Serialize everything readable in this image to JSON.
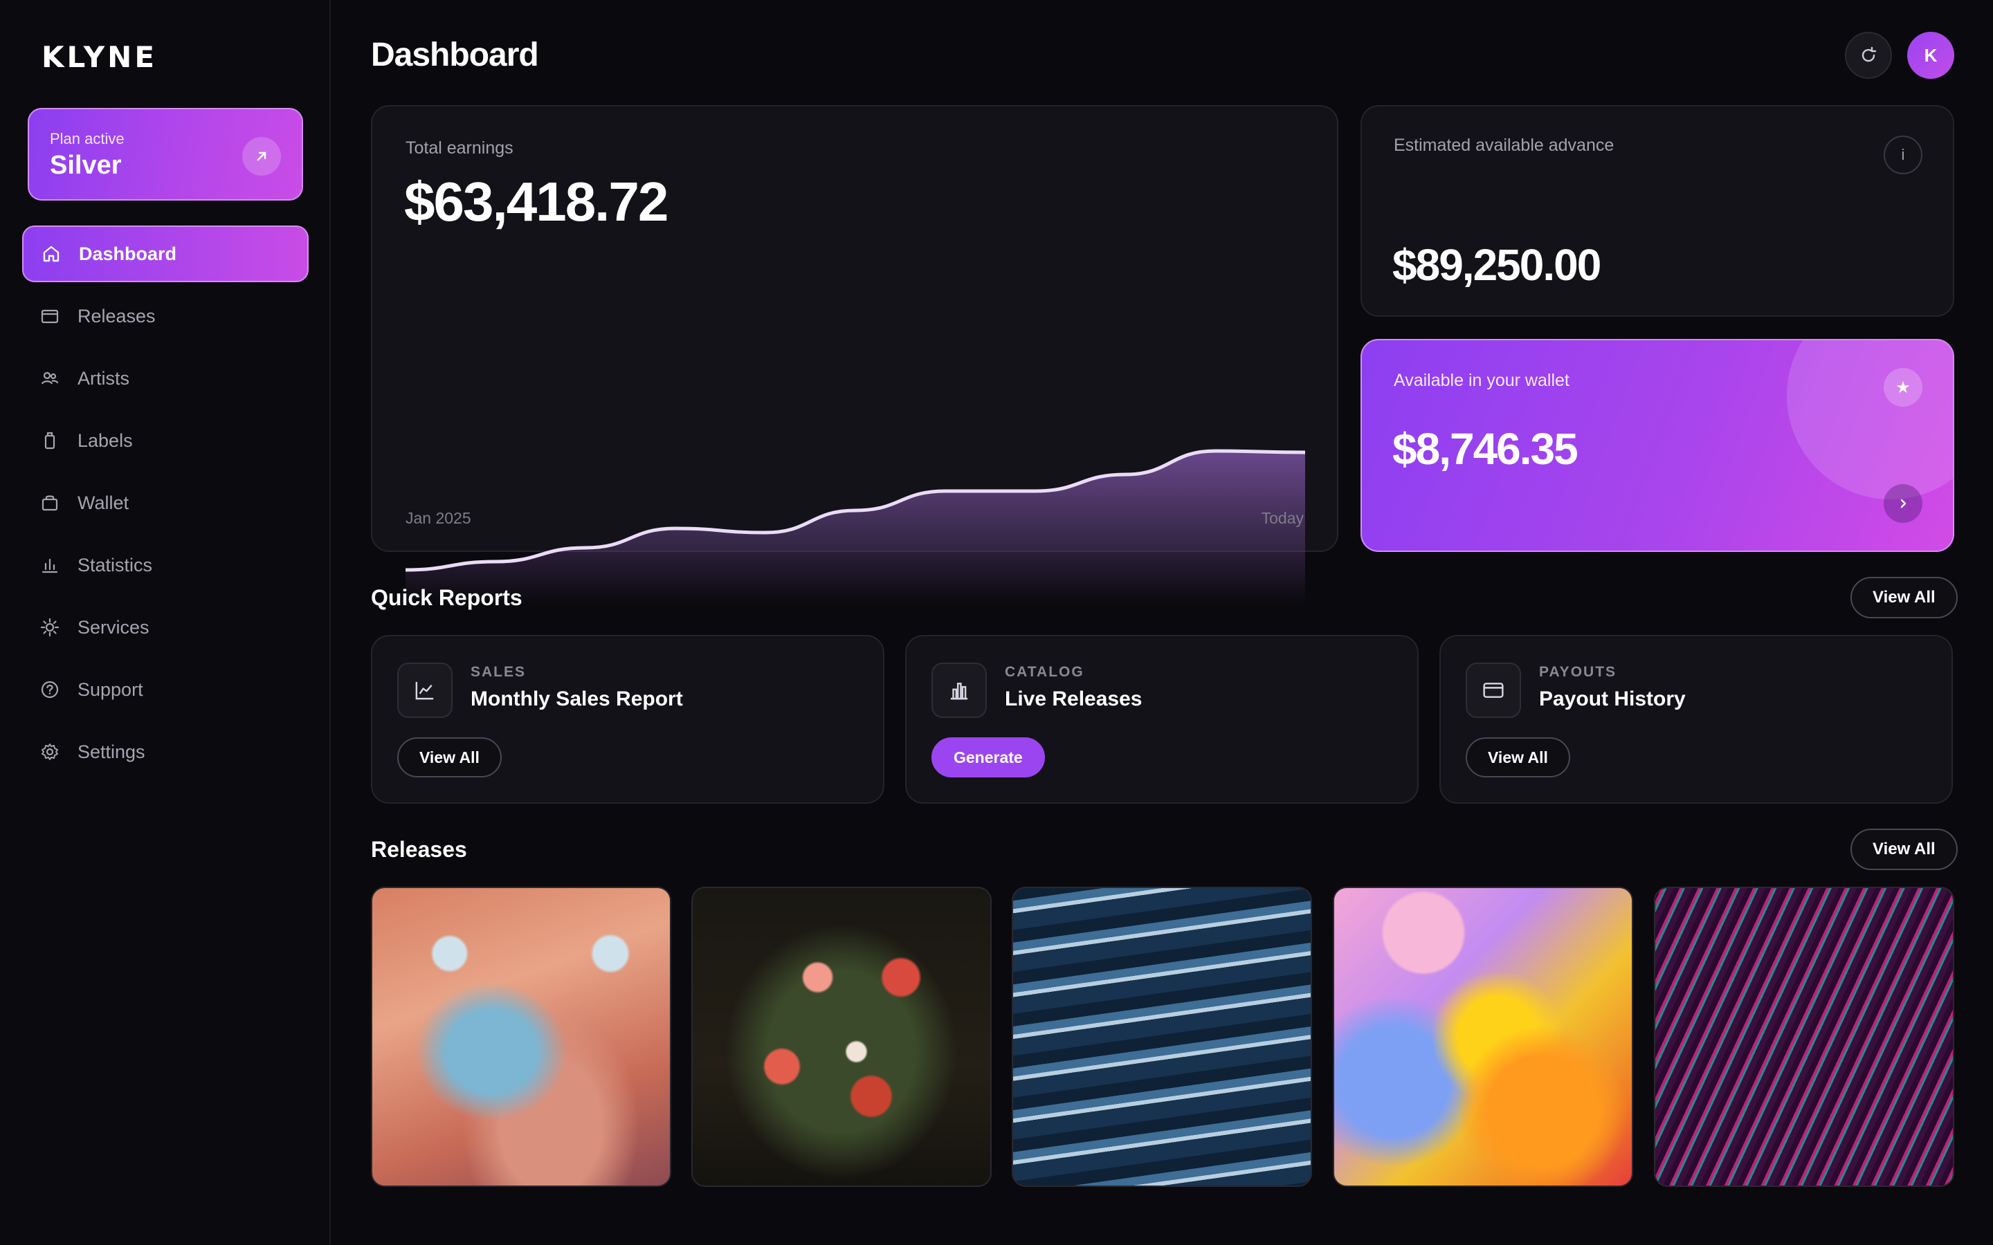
{
  "app": {
    "logo": "KLYNE"
  },
  "plan": {
    "label": "Plan active",
    "name": "Silver"
  },
  "sidebar": {
    "items": [
      {
        "label": "Dashboard",
        "icon": "home-icon",
        "active": true
      },
      {
        "label": "Releases",
        "icon": "release-icon"
      },
      {
        "label": "Artists",
        "icon": "users-icon"
      },
      {
        "label": "Labels",
        "icon": "label-icon"
      },
      {
        "label": "Wallet",
        "icon": "wallet-icon"
      },
      {
        "label": "Statistics",
        "icon": "bar-chart-icon"
      },
      {
        "label": "Services",
        "icon": "sun-icon"
      },
      {
        "label": "Support",
        "icon": "help-icon"
      },
      {
        "label": "Settings",
        "icon": "gear-icon"
      }
    ]
  },
  "header": {
    "title": "Dashboard",
    "avatar_initial": "K"
  },
  "earnings": {
    "label": "Total earnings",
    "value": "$63,418.72",
    "axis_start": "Jan 2025",
    "axis_end": "Today"
  },
  "chart_data": {
    "type": "area",
    "x": [
      0,
      1,
      2,
      3,
      4,
      5,
      6,
      7,
      8,
      9,
      10
    ],
    "values": [
      0.0,
      0.06,
      0.16,
      0.3,
      0.27,
      0.43,
      0.57,
      0.57,
      0.69,
      0.86,
      0.85
    ],
    "ylim": [
      0,
      1
    ],
    "grid": false,
    "line_color": "#eadcf7",
    "fill_color": "#6d4a91"
  },
  "advance": {
    "label": "Estimated available advance",
    "value": "$89,250.00",
    "info": "i"
  },
  "wallet": {
    "label": "Available in your wallet",
    "value": "$8,746.35",
    "star": "★"
  },
  "quick_reports": {
    "title": "Quick Reports",
    "view_all": "View All",
    "items": [
      {
        "category": "SALES",
        "title": "Monthly Sales Report",
        "button": "View All",
        "icon": "line-chart-icon"
      },
      {
        "category": "CATALOG",
        "title": "Live Releases",
        "button": "Generate",
        "icon": "bar-chart-icon"
      },
      {
        "category": "PAYOUTS",
        "title": "Payout History",
        "button": "View All",
        "icon": "credit-card-icon"
      }
    ]
  },
  "releases": {
    "title": "Releases",
    "view_all": "View All"
  },
  "colors": {
    "accent": "#9b45f0",
    "accent_pink": "#c94ce6",
    "background": "#0a090d",
    "card": "#131218"
  }
}
